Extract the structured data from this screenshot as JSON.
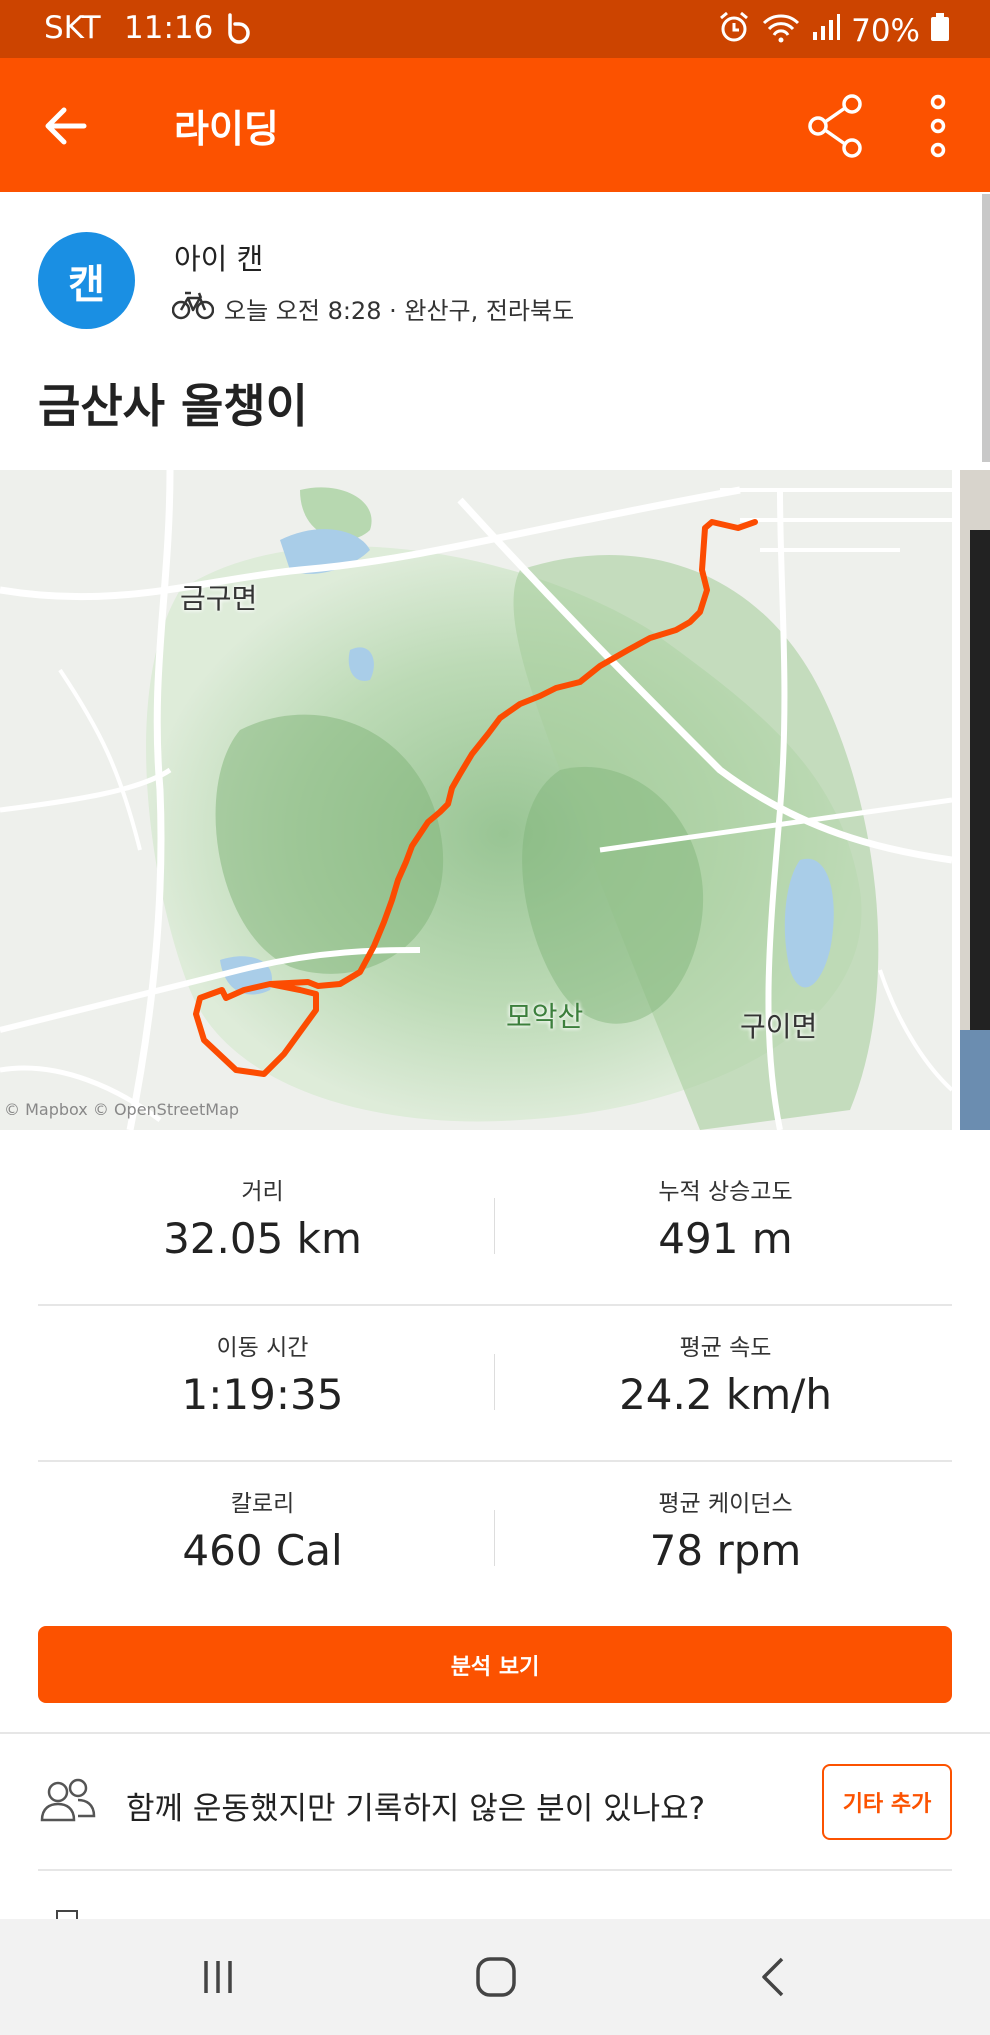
{
  "status_bar": {
    "carrier": "SKT",
    "time": "11:16",
    "battery": "70%",
    "icons": [
      "b-icon",
      "alarm-icon",
      "wifi-icon",
      "signal-icon",
      "battery-icon"
    ]
  },
  "app_bar": {
    "title": "라이딩",
    "icons": [
      "back-arrow-icon",
      "share-icon",
      "more-vertical-icon"
    ]
  },
  "athlete": {
    "avatar_text": "캔",
    "name": "아이 캔",
    "meta": "오늘 오전 8:28 · 완산구, 전라북도",
    "activity_icon": "bicycle-icon"
  },
  "activity": {
    "title": "금산사 올챙이"
  },
  "map": {
    "labels": {
      "geumgu": "금구면",
      "moak": "모악산",
      "gui": "구이면"
    },
    "attribution": "© Mapbox © OpenStreetMap",
    "route_color": "#fc4c02"
  },
  "stats": [
    {
      "label": "거리",
      "value": "32.05 km"
    },
    {
      "label": "누적 상승고도",
      "value": "491 m"
    },
    {
      "label": "이동 시간",
      "value": "1:19:35"
    },
    {
      "label": "평균 속도",
      "value": "24.2 km/h"
    },
    {
      "label": "칼로리",
      "value": "460 Cal"
    },
    {
      "label": "평균 케이던스",
      "value": "78 rpm"
    }
  ],
  "analysis_button": "분석 보기",
  "others_prompt": {
    "question": "함께 운동했지만 기록하지 않은 분이 있나요?",
    "button": "기타 추가",
    "icon": "group-icon"
  },
  "nav_bar": {
    "icons": [
      "recent-apps-icon",
      "home-icon",
      "back-icon"
    ]
  },
  "colors": {
    "brand": "#fc5200",
    "status_bar": "#cc4400",
    "avatar": "#1a8fe3"
  }
}
